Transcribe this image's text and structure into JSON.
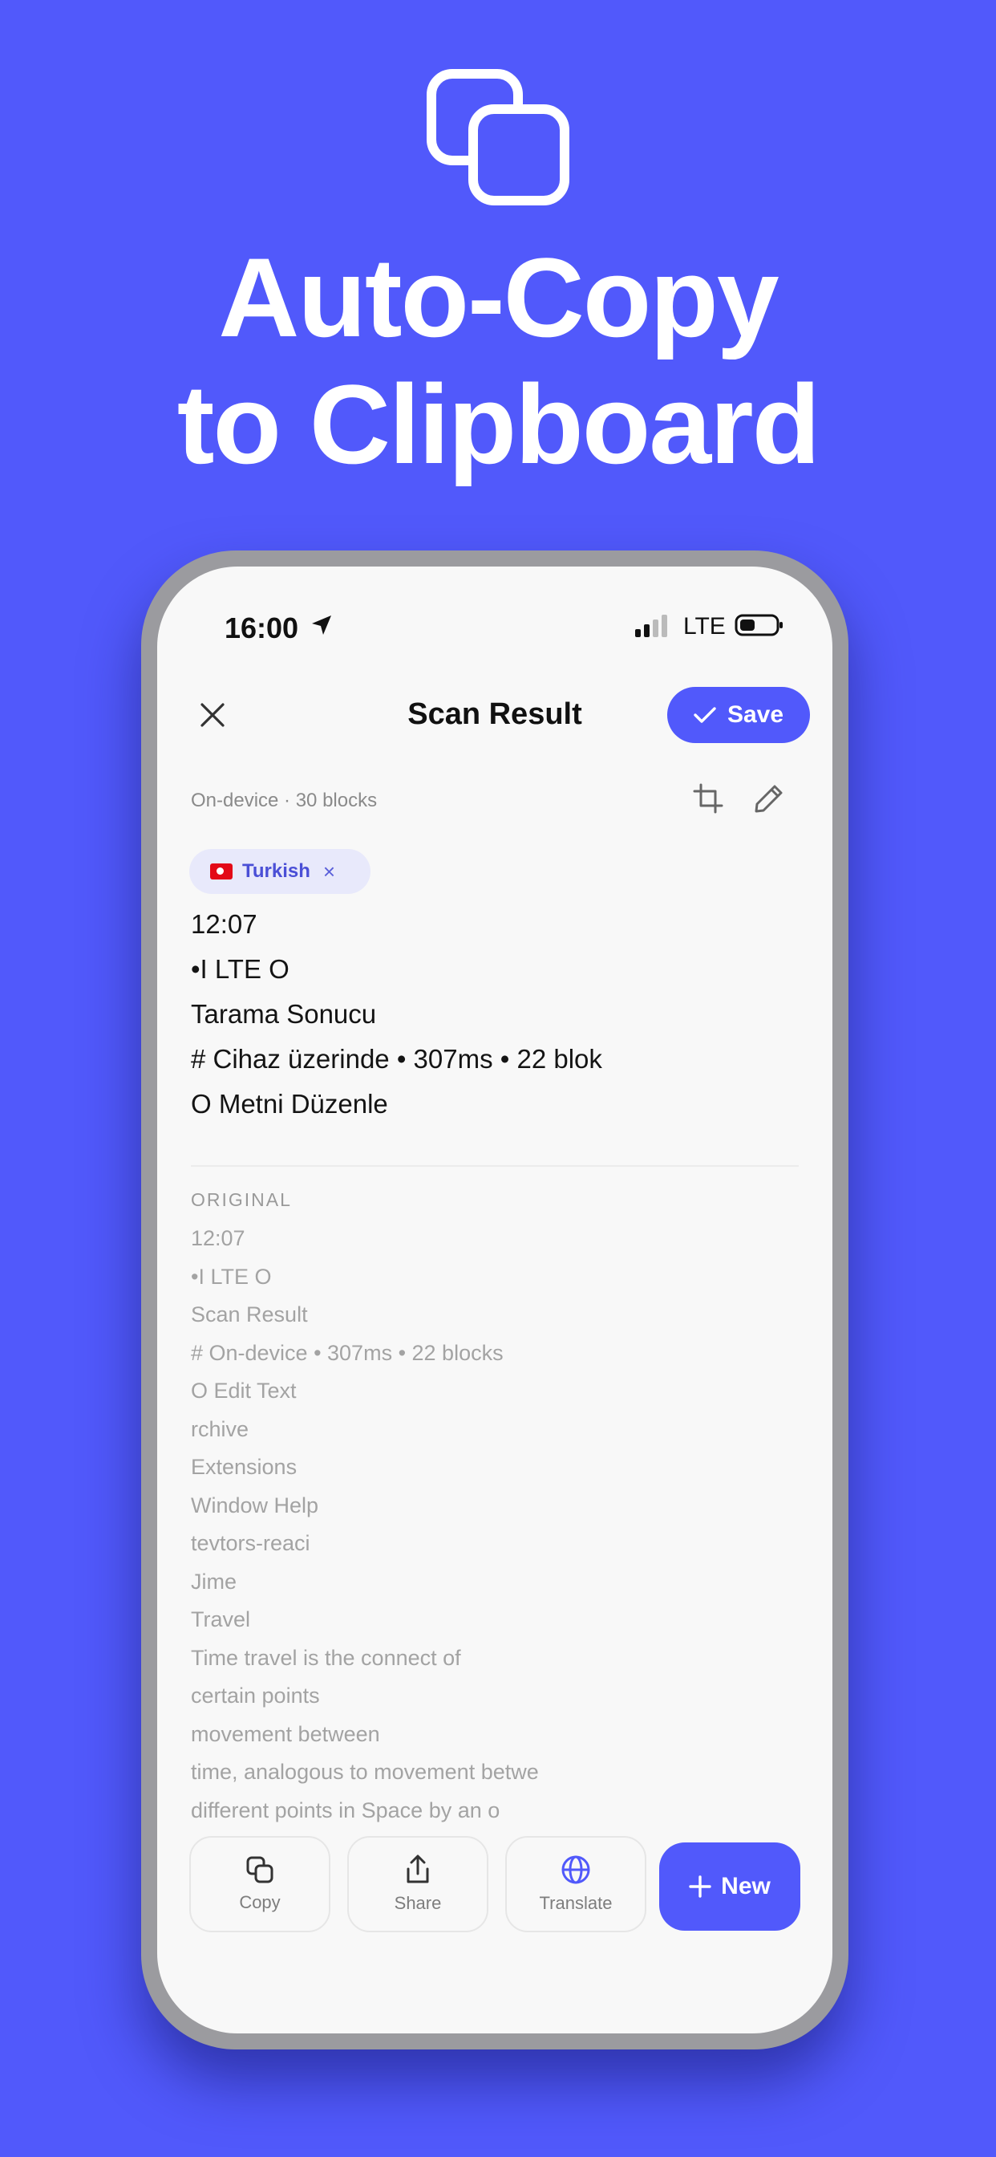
{
  "headline": {
    "line1": "Auto-Copy",
    "line2": "to Clipboard",
    "icon": "copy-icon",
    "background": "#5159fb"
  },
  "status_bar": {
    "time": "16:00",
    "network": "LTE"
  },
  "nav": {
    "title": "Scan Result",
    "save_label": "Save"
  },
  "meta": {
    "info": "On-device · 30 blocks"
  },
  "language_chip": {
    "label": "Turkish"
  },
  "result_lines": [
    "12:07",
    "•I LTE O",
    "Tarama Sonucu",
    "# Cihaz üzerinde • 307ms • 22 blok",
    "O Metni Düzenle"
  ],
  "original": {
    "label": "ORIGINAL",
    "lines": [
      "12:07",
      "•I LTE O",
      "Scan Result",
      "# On-device • 307ms • 22 blocks",
      "O Edit Text",
      "rchive",
      "Extensions",
      "Window Help",
      "tevtors-reaci",
      "Jime",
      "Travel",
      "Time travel is the connect of",
      "certain points",
      "movement between",
      "time, analogous to movement betwe",
      "different points in Space by an o"
    ]
  },
  "actions": {
    "copy": "Copy",
    "share": "Share",
    "translate": "Translate",
    "new": "New"
  },
  "colors": {
    "accent": "#5159fb",
    "chip_bg": "#e8e9fb"
  }
}
